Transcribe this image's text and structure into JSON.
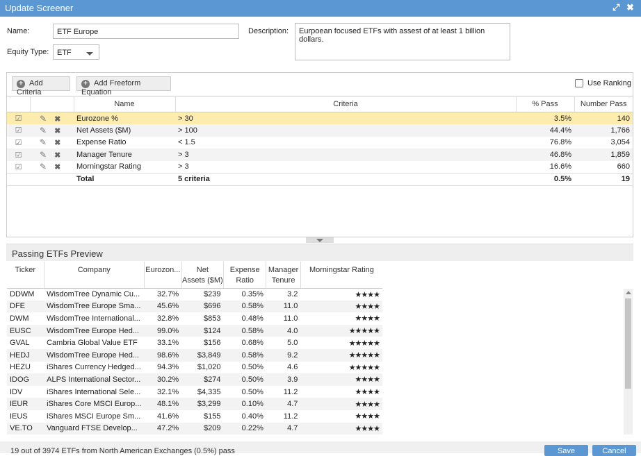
{
  "window": {
    "title": "Update Screener"
  },
  "form": {
    "name_label": "Name:",
    "name_value": "ETF Europe",
    "equity_label": "Equity Type:",
    "equity_value": "ETF",
    "description_label": "Description:",
    "description_value": "Eurpoean focused ETFs with assest of at least 1 billion dollars."
  },
  "toolbar": {
    "add_criteria": "Add Criteria",
    "add_freeform": "Add Freeform Equation",
    "use_ranking": "Use Ranking"
  },
  "criteria": {
    "headers": [
      "Name",
      "Criteria",
      "% Pass",
      "Number Pass"
    ],
    "rows": [
      {
        "name": "Eurozone %",
        "criteria": "> 30",
        "pct": "3.5%",
        "num": "140"
      },
      {
        "name": "Net Assets ($M)",
        "criteria": "> 100",
        "pct": "44.4%",
        "num": "1,766"
      },
      {
        "name": "Expense Ratio",
        "criteria": "< 1.5",
        "pct": "76.8%",
        "num": "3,054"
      },
      {
        "name": "Manager Tenure",
        "criteria": "> 3",
        "pct": "46.8%",
        "num": "1,859"
      },
      {
        "name": "Morningstar Rating",
        "criteria": "> 3",
        "pct": "16.6%",
        "num": "660"
      }
    ],
    "total": {
      "name": "Total",
      "criteria": "5 criteria",
      "pct": "0.5%",
      "num": "19"
    }
  },
  "preview": {
    "title": "Passing ETFs Preview",
    "headers": {
      "ticker": "Ticker",
      "company": "Company",
      "eurozone": "Eurozon...",
      "net_assets_1": "Net",
      "net_assets_2": "Assets ($M)",
      "expense_1": "Expense",
      "expense_2": "Ratio",
      "manager_1": "Manager",
      "manager_2": "Tenure",
      "rating": "Morningstar Rating"
    },
    "rows": [
      {
        "ticker": "DDWM",
        "company": "WisdomTree Dynamic Cu...",
        "eurozone": "32.7%",
        "assets": "$239",
        "expense": "0.35%",
        "tenure": "3.2",
        "rating": "★★★★"
      },
      {
        "ticker": "DFE",
        "company": "WisdomTree Europe Sma...",
        "eurozone": "45.6%",
        "assets": "$696",
        "expense": "0.58%",
        "tenure": "11.0",
        "rating": "★★★★"
      },
      {
        "ticker": "DWM",
        "company": "WisdomTree International...",
        "eurozone": "32.8%",
        "assets": "$853",
        "expense": "0.48%",
        "tenure": "11.0",
        "rating": "★★★★"
      },
      {
        "ticker": "EUSC",
        "company": "WisdomTree Europe Hed...",
        "eurozone": "99.0%",
        "assets": "$124",
        "expense": "0.58%",
        "tenure": "4.0",
        "rating": "★★★★★"
      },
      {
        "ticker": "GVAL",
        "company": "Cambria Global Value ETF",
        "eurozone": "33.1%",
        "assets": "$156",
        "expense": "0.68%",
        "tenure": "5.0",
        "rating": "★★★★★"
      },
      {
        "ticker": "HEDJ",
        "company": "WisdomTree Europe Hed...",
        "eurozone": "98.6%",
        "assets": "$3,849",
        "expense": "0.58%",
        "tenure": "9.2",
        "rating": "★★★★★"
      },
      {
        "ticker": "HEZU",
        "company": "iShares Currency Hedged...",
        "eurozone": "94.3%",
        "assets": "$1,020",
        "expense": "0.50%",
        "tenure": "4.6",
        "rating": "★★★★★"
      },
      {
        "ticker": "IDOG",
        "company": "ALPS International Sector...",
        "eurozone": "30.2%",
        "assets": "$274",
        "expense": "0.50%",
        "tenure": "3.9",
        "rating": "★★★★"
      },
      {
        "ticker": "IDV",
        "company": "iShares International Sele...",
        "eurozone": "32.1%",
        "assets": "$4,335",
        "expense": "0.50%",
        "tenure": "11.2",
        "rating": "★★★★"
      },
      {
        "ticker": "IEUR",
        "company": "iShares Core MSCI Europ...",
        "eurozone": "48.1%",
        "assets": "$3,299",
        "expense": "0.10%",
        "tenure": "4.7",
        "rating": "★★★★"
      },
      {
        "ticker": "IEUS",
        "company": "iShares MSCI Europe Sm...",
        "eurozone": "41.6%",
        "assets": "$155",
        "expense": "0.40%",
        "tenure": "11.2",
        "rating": "★★★★"
      },
      {
        "ticker": "VE.TO",
        "company": "Vanguard FTSE Develop...",
        "eurozone": "47.2%",
        "assets": "$209",
        "expense": "0.22%",
        "tenure": "4.7",
        "rating": "★★★★"
      }
    ]
  },
  "footer": {
    "status": "19 out of 3974 ETFs from North American Exchanges (0.5%) pass",
    "save": "Save",
    "cancel": "Cancel"
  },
  "icons": {
    "expand": "expand-icon",
    "close": "close-icon",
    "check": "check-icon",
    "edit": "edit-icon",
    "delete": "delete-icon",
    "add": "plus-icon"
  },
  "colors": {
    "titlebar": "#5b97d3",
    "selected_row": "#fcecae",
    "primary_button": "#5b97d3"
  }
}
